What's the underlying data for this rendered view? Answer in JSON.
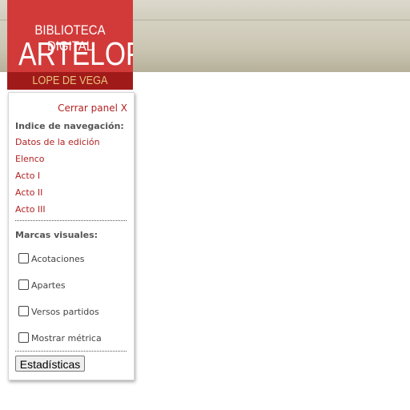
{
  "logo": {
    "line1": "BIBLIOTECA DIGITAL",
    "line2": "ARTELOPE",
    "line3": "LOPE DE VEGA"
  },
  "panel": {
    "close_label": "Cerrar panel X",
    "nav_title": "Indice de navegación:",
    "nav_items": [
      {
        "label": "Datos de la edición"
      },
      {
        "label": "Elenco"
      },
      {
        "label": "Acto I"
      },
      {
        "label": "Acto II"
      },
      {
        "label": "Acto III"
      }
    ],
    "marks_title": "Marcas visuales:",
    "checkboxes": [
      {
        "label": "Acotaciones",
        "checked": false
      },
      {
        "label": "Apartes",
        "checked": false
      },
      {
        "label": "Versos partidos",
        "checked": false
      },
      {
        "label": "Mostrar métrica",
        "checked": false
      }
    ],
    "stats_button": "Estadísticas"
  },
  "colors": {
    "logo_red": "#d23a3a",
    "logo_dark_red": "#a11a1a",
    "link_red": "#b22222",
    "logo_gold": "#e8c27a"
  }
}
